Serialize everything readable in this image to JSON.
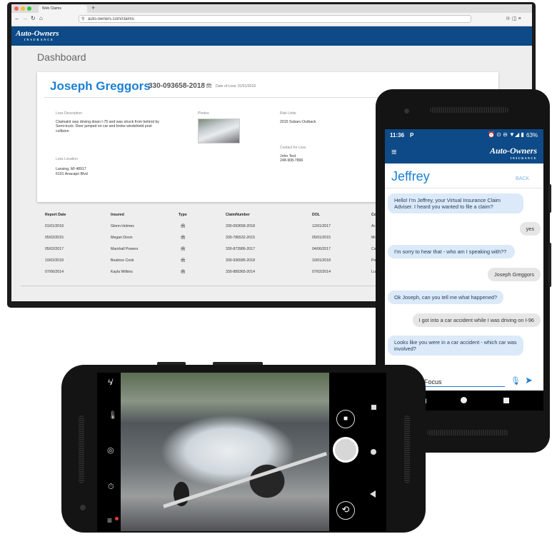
{
  "browser": {
    "tab_title": "Web Claims",
    "new_tab": "+",
    "url": "auto-owners.com/claims",
    "toolbar_right_icons": "⊪ ◫ ≡"
  },
  "brand": {
    "name": "Auto-Owners",
    "tagline": "INSURANCE",
    "color": "#0d4a87",
    "accent": "#1a7fd4"
  },
  "dashboard": {
    "title": "Dashboard",
    "claim": {
      "name": "Joseph Greggors",
      "claim_number": "330-093658-2018",
      "date_of_loss_label": "Date of Loss: 01/01/2018",
      "loss_description_label": "Loss Description",
      "loss_description": "Claimaint was driving down I-75 and was struck from behind by Semi-truck. Deer jumped on car and broke windshield post collision",
      "photos_label": "Photos",
      "risk_units_label": "Risk Units",
      "risk_unit": "2015 Subaru Outback",
      "contact_label": "Contact for Loss",
      "contact_name": "John Test",
      "contact_phone": "248-908-7896",
      "loss_location_label": "Loss Location",
      "loss_location_line1": "Lansing, MI 48917",
      "loss_location_line2": "6101 Anacapri Blvd"
    },
    "table": {
      "headers": [
        "Report Date",
        "Insured",
        "Type",
        "ClaimNumber",
        "DOL",
        "Co"
      ],
      "rows": [
        [
          "01/01/2018",
          "Glenn Holmes",
          "330-093658-2018",
          "12/01/2017",
          "Ar"
        ],
        [
          "05/02/2015",
          "Megan Dixon",
          "330-786532-2015",
          "05/01/2015",
          "Mi"
        ],
        [
          "05/02/2017",
          "Marshall Powers",
          "330-873986-2017",
          "04/06/2017",
          "Ca"
        ],
        [
          "10/02/2018",
          "Beatrice Cook",
          "330-936585-2018",
          "10/01/2018",
          "Pe"
        ],
        [
          "07/06/2014",
          "Kayla Wilkins",
          "330-889365-2014",
          "07/02/2014",
          "Lu"
        ]
      ]
    }
  },
  "phone": {
    "status": {
      "time": "11:36",
      "app_icon": "P",
      "battery": "63%"
    },
    "app_name": "Auto-Owners",
    "app_tagline": "INSURANCE",
    "bot_name": "Jeffrey",
    "back": "BACK",
    "messages": [
      {
        "from": "bot",
        "text": "Hello! I'm Jeffrey, your Virtual Insurance Claim Adviser. I heard you wanted to file a claim?"
      },
      {
        "from": "user",
        "text": "yes"
      },
      {
        "from": "bot",
        "text": "I'm sorry to hear that - who am I speaking with??"
      },
      {
        "from": "user",
        "text": "Joseph Greggors"
      },
      {
        "from": "bot",
        "text": "Ok Joseph, can you tell me what happened?"
      },
      {
        "from": "user",
        "text": "I got into a car accident while I was driving on I-96"
      },
      {
        "from": "bot",
        "text": "Looks like you were in a car accident - which car was involved?"
      }
    ],
    "input_value": "Focus"
  },
  "camera": {
    "icons": [
      "flash-off-icon",
      "temperature-icon",
      "hdr-icon",
      "timer-off-icon",
      "menu-icon"
    ],
    "notification_color": "#e53935"
  }
}
